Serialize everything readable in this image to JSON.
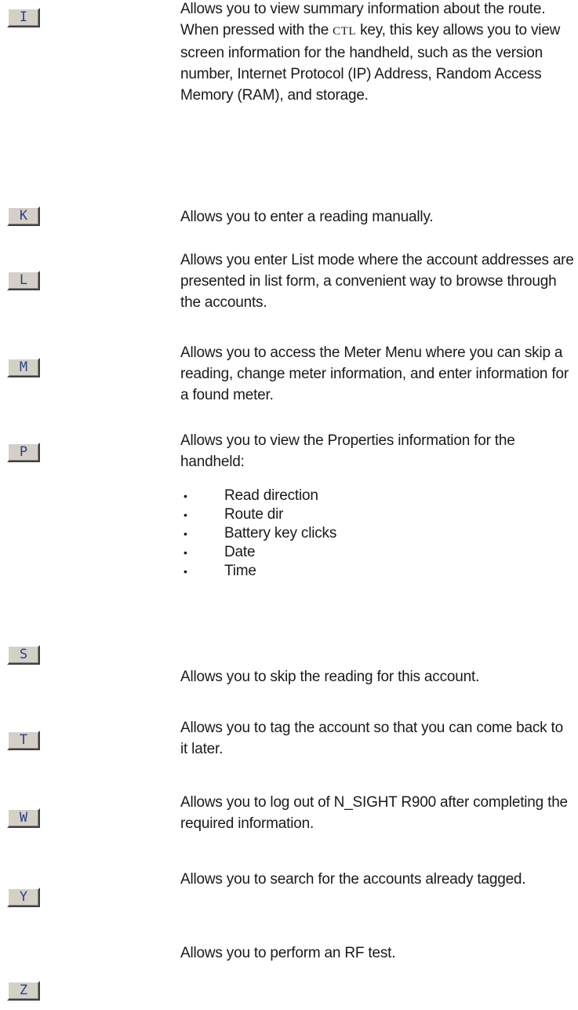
{
  "entries": [
    {
      "key": "I",
      "text_before_ctl": "Allows you to view summary information about the route. When pressed with the ",
      "ctl": "CTL",
      "text_after_ctl": " key, this key allows you to view screen information for the handheld, such as the version number, Internet Protocol (IP) Address, Random Access Memory (RAM), and storage."
    },
    {
      "key": "K",
      "text": "Allows you to enter a reading manually."
    },
    {
      "key": "L",
      "text": "Allows you enter List mode where the account addresses are presented in list form, a convenient way to browse through the accounts."
    },
    {
      "key": "M",
      "text": "Allows you to access the Meter Menu where you can skip a reading, change meter information, and enter information for a found meter."
    },
    {
      "key": "P",
      "text": "Allows you to view the Properties information for the handheld:",
      "bullet_glyph": "•",
      "items": [
        "Read direction",
        "Route dir",
        "Battery key clicks",
        "Date",
        "Time"
      ]
    },
    {
      "key": "S",
      "text": "Allows you to skip the reading for this account."
    },
    {
      "key": "T",
      "text": "Allows you to tag the account so that you can come back to it later."
    },
    {
      "key": "W",
      "text": "Allows you to log out of N_SIGHT R900 after completing the required information."
    },
    {
      "key": "Y",
      "text": "Allows you to search for the accounts already tagged."
    },
    {
      "key": "Z",
      "text": "Allows you to perform an RF test."
    }
  ]
}
